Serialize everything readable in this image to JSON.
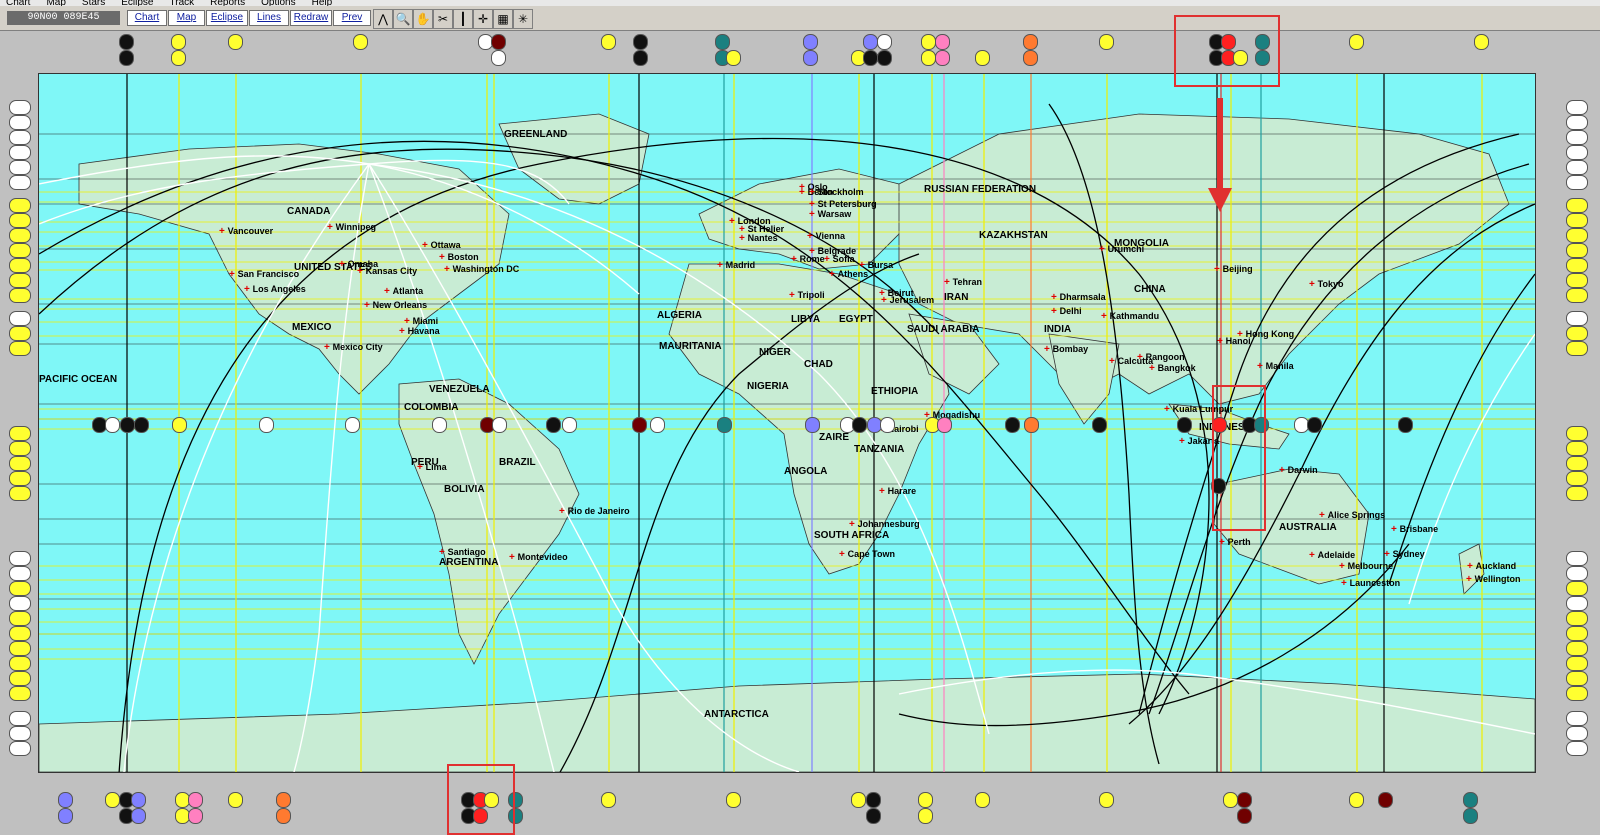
{
  "menu": [
    "Chart",
    "Map",
    "Stars",
    "Eclipse",
    "Track",
    "Reports",
    "Options",
    "Help"
  ],
  "toolbar": {
    "coordinate": "90N00 089E45",
    "buttons": [
      "Chart",
      "Map",
      "Eclipse",
      "Lines",
      "Redraw",
      "Prev"
    ]
  },
  "map": {
    "countries": [
      {
        "name": "GREENLAND"
      },
      {
        "name": "CANADA"
      },
      {
        "name": "UNITED STATES"
      },
      {
        "name": "MEXICO"
      },
      {
        "name": "VENEZUELA"
      },
      {
        "name": "COLOMBIA"
      },
      {
        "name": "PERU"
      },
      {
        "name": "BRAZIL"
      },
      {
        "name": "BOLIVIA"
      },
      {
        "name": "ARGENTINA"
      },
      {
        "name": "ALGERIA"
      },
      {
        "name": "LIBYA"
      },
      {
        "name": "EGYPT"
      },
      {
        "name": "MAURITANIA"
      },
      {
        "name": "NIGER"
      },
      {
        "name": "CHAD"
      },
      {
        "name": "NIGERIA"
      },
      {
        "name": "ETHIOPIA"
      },
      {
        "name": "ZAIRE"
      },
      {
        "name": "TANZANIA"
      },
      {
        "name": "ANGOLA"
      },
      {
        "name": "SOUTH AFRICA"
      },
      {
        "name": "RUSSIAN FEDERATION"
      },
      {
        "name": "KAZAKHSTAN"
      },
      {
        "name": "MONGOLIA"
      },
      {
        "name": "CHINA"
      },
      {
        "name": "IRAN"
      },
      {
        "name": "SAUDI ARABIA"
      },
      {
        "name": "INDIA"
      },
      {
        "name": "INDONESIA"
      },
      {
        "name": "AUSTRALIA"
      },
      {
        "name": "ANTARCTICA"
      },
      {
        "name": "PACIFIC OCEAN"
      }
    ],
    "cities": [
      "Vancouver",
      "Winnipeg",
      "San Francisco",
      "Los Angeles",
      "Omaha",
      "Kansas City",
      "Ottawa",
      "Boston",
      "Washington DC",
      "Atlanta",
      "New Orleans",
      "Miami",
      "Havana",
      "Mexico City",
      "Lima",
      "Rio de Janeiro",
      "Santiago",
      "Montevideo",
      "London",
      "St Helier",
      "Nantes",
      "Madrid",
      "Rome",
      "Vienna",
      "Belgrade",
      "Sofia",
      "Athens",
      "Bursa",
      "Berlin",
      "Warsaw",
      "Oslo",
      "Stockholm",
      "St Petersburg",
      "Tripoli",
      "Beirut",
      "Jerusalem",
      "Tehran",
      "Mogadishu",
      "Nairobi",
      "Harare",
      "Johannesburg",
      "Cape Town",
      "Dharmsala",
      "Delhi",
      "Kathmandu",
      "Calcutta",
      "Bombay",
      "Rangoon",
      "Bangkok",
      "Hanoi",
      "Hong Kong",
      "Manila",
      "Beijing",
      "Tokyo",
      "Urumchi",
      "Kuala Lumpur",
      "Jakarta",
      "Darwin",
      "Alice Springs",
      "Brisbane",
      "Perth",
      "Adelaide",
      "Sydney",
      "Melbourne",
      "Launceston",
      "Auckland",
      "Wellington"
    ]
  },
  "colors": {
    "ocean": "#7ff7f7",
    "land": "#c8ecd4",
    "red_highlight": "#e03030",
    "line_white": "#ffffff",
    "line_yellow": "#f0f000",
    "line_black": "#000000"
  }
}
